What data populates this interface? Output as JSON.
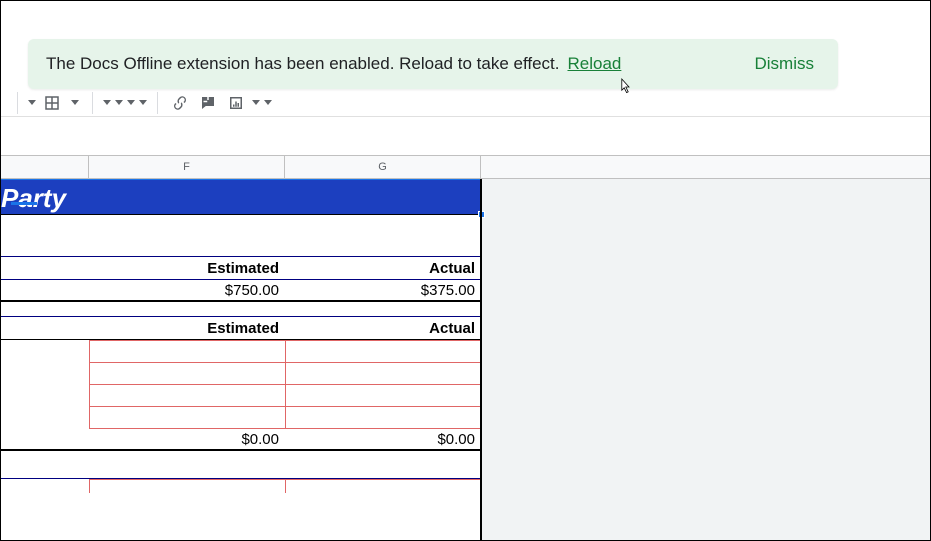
{
  "banner": {
    "message": "The Docs Offline extension has been enabled. Reload to take effect.",
    "reload_label": "Reload",
    "dismiss_label": "Dismiss"
  },
  "columns": {
    "F": "F",
    "G": "G"
  },
  "title": "Party",
  "headers": {
    "estimated": "Estimated",
    "actual": "Actual"
  },
  "row1": {
    "estimated": "$750.00",
    "actual": "$375.00"
  },
  "totals": {
    "estimated": "$0.00",
    "actual": "$0.00"
  },
  "toolbar": {
    "fill_color": "#1a73e8"
  }
}
